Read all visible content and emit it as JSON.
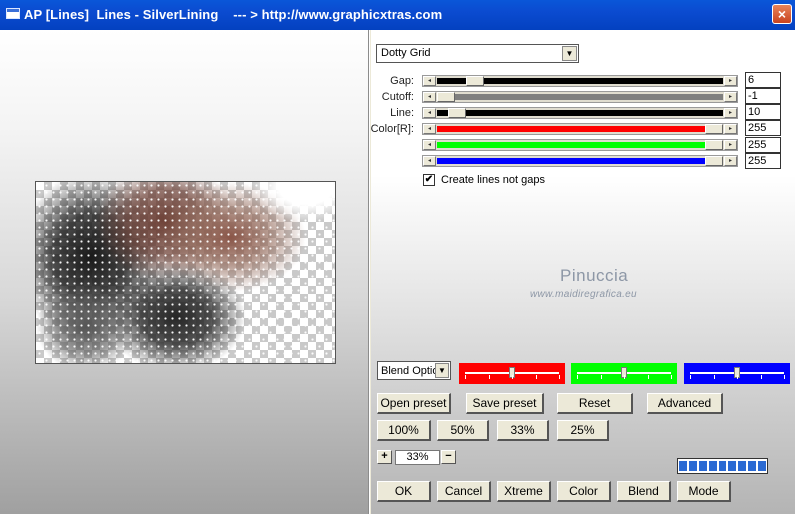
{
  "window": {
    "title": "AP [Lines]  Lines - SilverLining    --- > http://www.graphicxtras.com",
    "close_glyph": "×"
  },
  "preset_select": {
    "value": "Dotty Grid",
    "arrow": "▼"
  },
  "params": [
    {
      "label": "Gap:",
      "value": "6",
      "fill_color": "#000000",
      "thumb": 0.11
    },
    {
      "label": "Cutoff:",
      "value": "-1",
      "fill_color": "#7f7f7f",
      "thumb": 0.0
    },
    {
      "label": "Line:",
      "value": "10",
      "fill_color": "#000000",
      "thumb": 0.04
    },
    {
      "label": "Color[R]:",
      "value": "255",
      "fill_color": "#ff0000",
      "thumb": 1.0
    },
    {
      "label": "",
      "value": "255",
      "fill_color": "#00ff00",
      "thumb": 1.0
    },
    {
      "label": "",
      "value": "255",
      "fill_color": "#0000ff",
      "thumb": 1.0
    }
  ],
  "scroll_left_glyph": "◂",
  "scroll_right_glyph": "▸",
  "checkbox": {
    "label": "Create lines not gaps",
    "checked": true,
    "mark": "✔"
  },
  "watermark": {
    "name": "Pinuccia",
    "url": "www.maidiregrafica.eu"
  },
  "blend_select": {
    "value": "Blend Options",
    "arrow": "▼"
  },
  "color_boxes": [
    {
      "color": "#ff0000",
      "level": 0.5
    },
    {
      "color": "#00ff00",
      "level": 0.5
    },
    {
      "color": "#0000ff",
      "level": 0.5
    }
  ],
  "buttons": {
    "open_preset": "Open preset",
    "save_preset": "Save preset",
    "reset": "Reset",
    "advanced": "Advanced",
    "zoom_100": "100%",
    "zoom_50": "50%",
    "zoom_33": "33%",
    "zoom_25": "25%",
    "ok": "OK",
    "cancel": "Cancel",
    "xtreme": "Xtreme",
    "color": "Color",
    "blend": "Blend",
    "mode": "Mode"
  },
  "zoom": {
    "plus": "+",
    "minus": "−",
    "value": "33%"
  },
  "progress": {
    "segments": 9
  }
}
